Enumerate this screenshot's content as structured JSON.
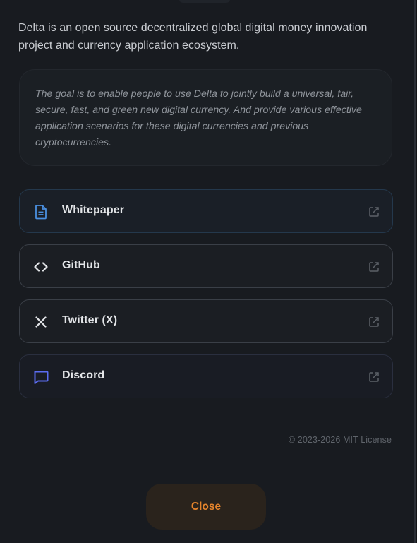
{
  "about": {
    "description": "Delta is an open source decentralized global digital money innovation project and currency application ecosystem.",
    "goal": "The goal is to enable people to use Delta to jointly build a universal, fair, secure, fast, and green new digital currency. And provide various effective application scenarios for these digital currencies and previous cryptocurrencies."
  },
  "links": [
    {
      "label": "Whitepaper",
      "icon": "document-icon",
      "color": "#4a8fe0"
    },
    {
      "label": "GitHub",
      "icon": "code-icon",
      "color": "#e3e5e8"
    },
    {
      "label": "Twitter (X)",
      "icon": "x-logo-icon",
      "color": "#e3e5e8"
    },
    {
      "label": "Discord",
      "icon": "chat-bubble-icon",
      "color": "#5b6cf0"
    }
  ],
  "external_icon": "external-link-icon",
  "footer": {
    "license": "© 2023-2026 MIT License"
  },
  "actions": {
    "close_label": "Close"
  },
  "colors": {
    "accent_orange": "#e5842c",
    "background": "#181b20"
  }
}
